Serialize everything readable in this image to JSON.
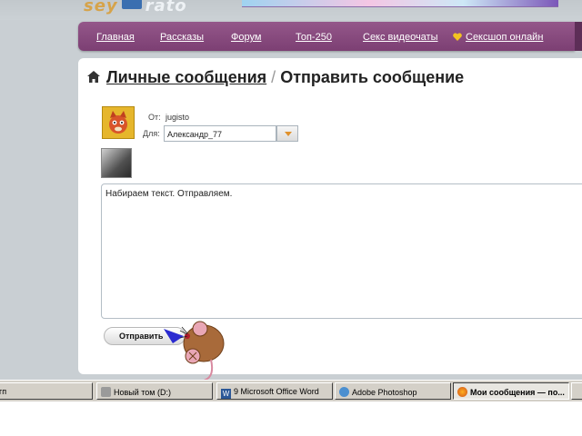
{
  "site": {
    "logo_left": "sey",
    "logo_right": "rato"
  },
  "nav": {
    "items": [
      "Главная",
      "Рассказы",
      "Форум",
      "Топ-250",
      "Секс видеочаты",
      "Сексшоп онлайн"
    ]
  },
  "page": {
    "breadcrumb": "Личные сообщения",
    "separator": "/",
    "title": "Отправить сообщение"
  },
  "form": {
    "from_label": "От:",
    "from_value": "jugisto",
    "to_label": "Для:",
    "to_value": "Александр_77",
    "message": "Набираем текст. Отправляем.",
    "send_label": "Отправить"
  },
  "taskbar": {
    "items": [
      "гп",
      "Новый том (D:)",
      "9 Microsoft Office Word",
      "Adobe Photoshop",
      "Мои сообщения — по..."
    ]
  },
  "colors": {
    "nav_bg": "#7c3f73",
    "accent": "#e0912c",
    "heart": "#f2c320"
  }
}
